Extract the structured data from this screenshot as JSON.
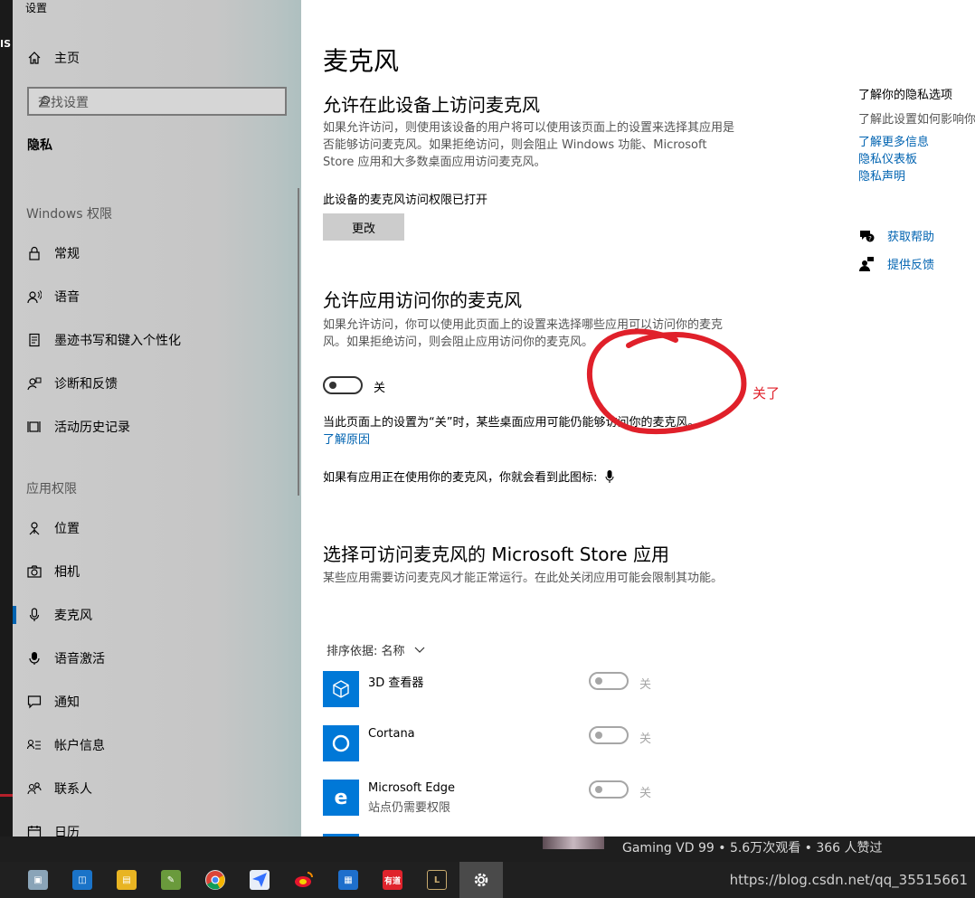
{
  "window": {
    "title": "设置"
  },
  "sidebar": {
    "home": "主页",
    "search_placeholder": "查找设置",
    "category": "隐私",
    "windows_section": "Windows 权限",
    "windows_items": [
      {
        "label": "常规",
        "icon": "lock-icon"
      },
      {
        "label": "语音",
        "icon": "speech-icon"
      },
      {
        "label": "墨迹书写和键入个性化",
        "icon": "inking-icon"
      },
      {
        "label": "诊断和反馈",
        "icon": "diagnostics-icon"
      },
      {
        "label": "活动历史记录",
        "icon": "activity-history-icon"
      }
    ],
    "app_section": "应用权限",
    "app_items": [
      {
        "label": "位置",
        "icon": "location-icon"
      },
      {
        "label": "相机",
        "icon": "camera-icon"
      },
      {
        "label": "麦克风",
        "icon": "microphone-icon",
        "active": true
      },
      {
        "label": "语音激活",
        "icon": "voice-activation-icon"
      },
      {
        "label": "通知",
        "icon": "notification-icon"
      },
      {
        "label": "帐户信息",
        "icon": "account-info-icon"
      },
      {
        "label": "联系人",
        "icon": "contacts-icon"
      },
      {
        "label": "日历",
        "icon": "calendar-icon"
      }
    ]
  },
  "main": {
    "title": "麦克风",
    "device_access": {
      "heading": "允许在此设备上访问麦克风",
      "desc": "如果允许访问，则使用该设备的用户将可以使用该页面上的设置来选择其应用是否能够访问麦克风。如果拒绝访问，则会阻止 Windows 功能、Microsoft Store 应用和大多数桌面应用访问麦克风。",
      "status": "此设备的麦克风访问权限已打开",
      "button": "更改"
    },
    "app_access": {
      "heading": "允许应用访问你的麦克风",
      "desc": "如果允许访问，你可以使用此页面上的设置来选择哪些应用可以访问你的麦克风。如果拒绝访问，则会阻止应用访问你的麦克风。",
      "toggle_label": "关",
      "toggle_on": false,
      "note": "当此页面上的设置为“关”时，某些桌面应用可能仍能够访问你的麦克风。",
      "note_link": "了解原因",
      "indicator": "如果有应用正在使用你的麦克风，你就会看到此图标:"
    },
    "annotation": "关了",
    "store_apps": {
      "heading": "选择可访问麦克风的 Microsoft Store 应用",
      "desc": "某些应用需要访问麦克风才能正常运行。在此处关闭应用可能会限制其功能。",
      "sort_label": "排序依据: 名称",
      "apps": [
        {
          "name": "3D 查看器",
          "sub": "",
          "toggle_label": "关",
          "icon": "3d-viewer-icon"
        },
        {
          "name": "Cortana",
          "sub": "",
          "toggle_label": "关",
          "icon": "cortana-icon"
        },
        {
          "name": "Microsoft Edge",
          "sub": "站点仍需要权限",
          "toggle_label": "关",
          "icon": "edge-icon"
        }
      ]
    }
  },
  "right": {
    "title": "了解你的隐私选项",
    "sub": "了解此设置如何影响你",
    "links": [
      "了解更多信息",
      "隐私仪表板",
      "隐私声明"
    ],
    "help": "获取帮助",
    "feedback": "提供反馈"
  },
  "background": {
    "video_text": "Gaming VD 99 • 5.6万次观看 • 366 人赞过",
    "watermark": "https://blog.csdn.net/qq_35515661"
  },
  "colors": {
    "accent": "#0063b1",
    "tile": "#0078d7",
    "annotation": "#e0202a"
  }
}
